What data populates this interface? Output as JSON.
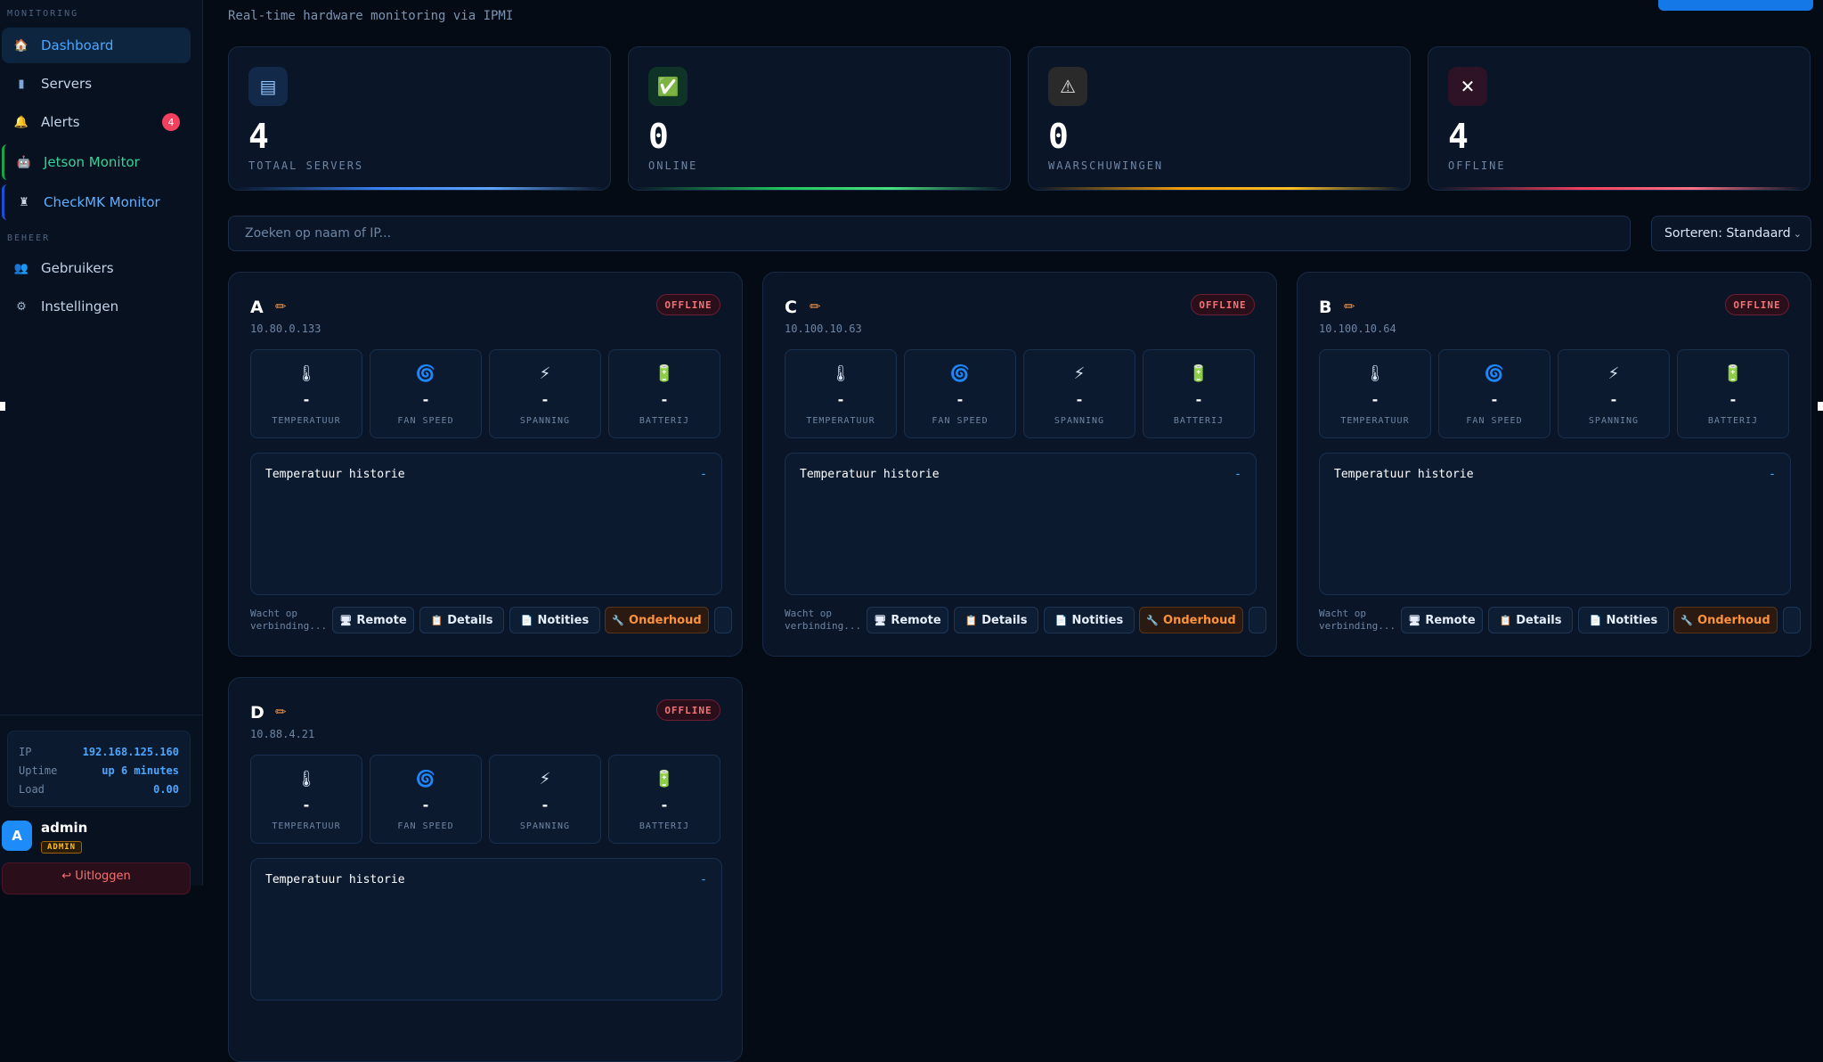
{
  "sidebar": {
    "section_monitoring": "MONITORING",
    "section_beheer": "BEHEER",
    "nav": {
      "dashboard": "Dashboard",
      "servers": "Servers",
      "alerts": "Alerts",
      "alerts_count": "4",
      "jetson": "Jetson Monitor",
      "checkmk": "CheckMK Monitor",
      "users": "Gebruikers",
      "settings": "Instellingen"
    },
    "system": {
      "ip_label": "IP",
      "ip": "192.168.125.160",
      "uptime_label": "Uptime",
      "uptime": "up 6 minutes",
      "load_label": "Load",
      "load": "0.00"
    },
    "user": {
      "initial": "A",
      "name": "admin",
      "role": "ADMIN"
    },
    "logout": "↩ Uitloggen"
  },
  "header": {
    "subtitle": "Real-time hardware monitoring via IPMI"
  },
  "stats": [
    {
      "value": "4",
      "label": "TOTAAL SERVERS",
      "icon": "server-icon",
      "color": "#3b82f6"
    },
    {
      "value": "0",
      "label": "ONLINE",
      "icon": "check-icon",
      "color": "#22c55e"
    },
    {
      "value": "0",
      "label": "WAARSCHUWINGEN",
      "icon": "warning-icon",
      "color": "#f59e0b"
    },
    {
      "value": "4",
      "label": "OFFLINE",
      "icon": "close-icon",
      "color": "#f43f5e"
    }
  ],
  "search": {
    "placeholder": "Zoeken op naam of IP..."
  },
  "sort": {
    "label": "Sorteren: Standaard"
  },
  "metric_labels": {
    "temp": "TEMPERATUUR",
    "fan": "FAN SPEED",
    "volt": "SPANNING",
    "batt": "BATTERIJ"
  },
  "card_common": {
    "history_title": "Temperatuur historie",
    "history_value": "-",
    "waiting": "Wacht op verbinding...",
    "btn_remote": "Remote",
    "btn_details": "Details",
    "btn_notes": "Notities",
    "btn_maint": "Onderhoud"
  },
  "servers": [
    {
      "name": "A",
      "ip": "10.80.0.133",
      "status": "OFFLINE",
      "temp": "-",
      "fan": "-",
      "volt": "-",
      "batt": "-"
    },
    {
      "name": "C",
      "ip": "10.100.10.63",
      "status": "OFFLINE",
      "temp": "-",
      "fan": "-",
      "volt": "-",
      "batt": "-"
    },
    {
      "name": "B",
      "ip": "10.100.10.64",
      "status": "OFFLINE",
      "temp": "-",
      "fan": "-",
      "volt": "-",
      "batt": "-"
    },
    {
      "name": "D",
      "ip": "10.88.4.21",
      "status": "OFFLINE",
      "temp": "-",
      "fan": "-",
      "volt": "-",
      "batt": "-"
    }
  ]
}
